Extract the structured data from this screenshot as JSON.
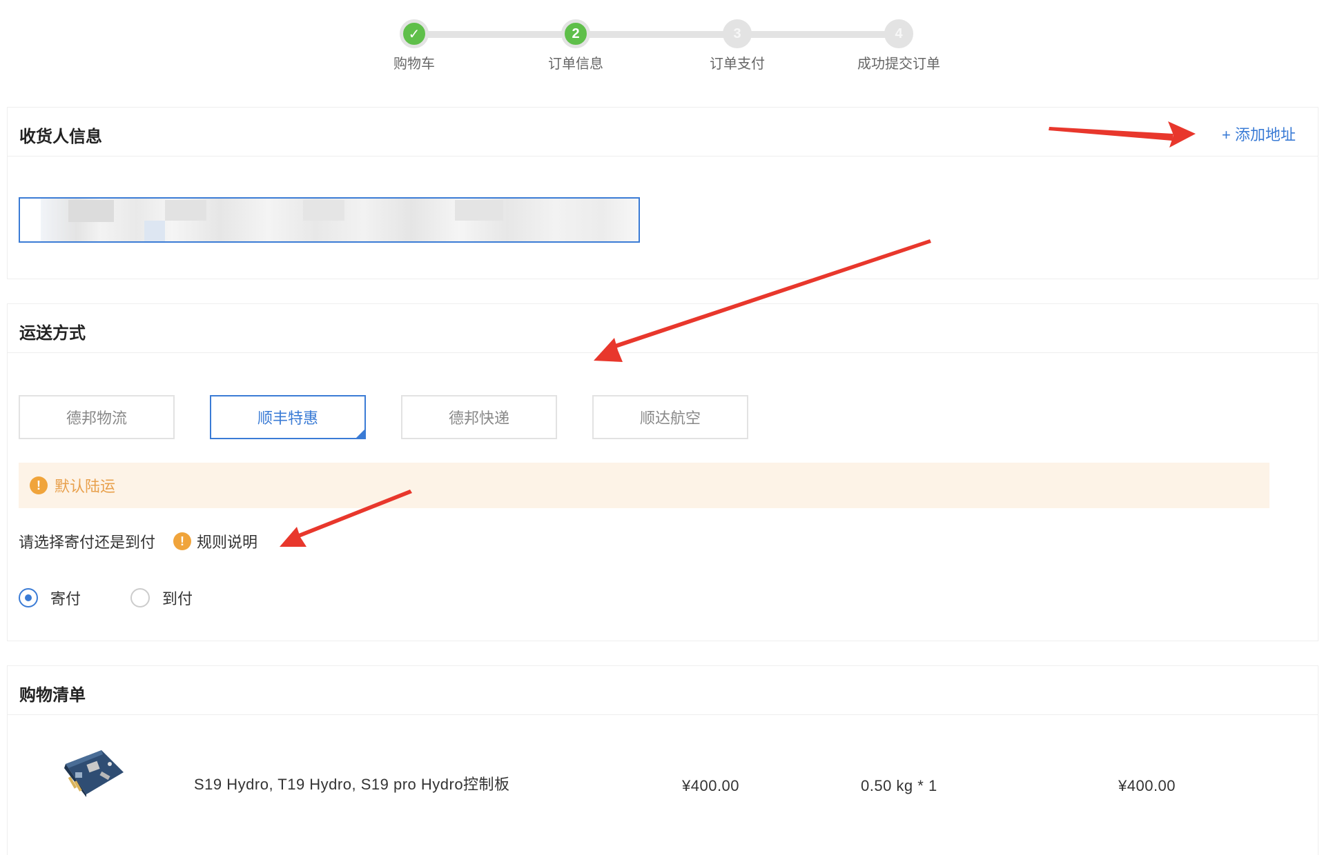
{
  "steps": [
    {
      "label": "购物车",
      "state": "done",
      "marker": "✓"
    },
    {
      "label": "订单信息",
      "state": "active",
      "marker": "2"
    },
    {
      "label": "订单支付",
      "state": "todo",
      "marker": "3"
    },
    {
      "label": "成功提交订单",
      "state": "todo",
      "marker": "4"
    }
  ],
  "consignee": {
    "title": "收货人信息",
    "add_address": "+ 添加地址"
  },
  "shipping": {
    "title": "运送方式",
    "options": [
      "德邦物流",
      "顺丰特惠",
      "德邦快递",
      "顺达航空"
    ],
    "selected_index": 1,
    "notice": "默认陆运",
    "question": "请选择寄付还是到付",
    "rules_link": "规则说明",
    "payment_options": [
      "寄付",
      "到付"
    ],
    "payment_selected": "寄付"
  },
  "cart": {
    "title": "购物清单",
    "items": [
      {
        "name": "S19 Hydro, T19 Hydro, S19 pro Hydro控制板",
        "unit_price": "¥400.00",
        "weight_qty": "0.50 kg * 1",
        "subtotal": "¥400.00"
      }
    ]
  },
  "colors": {
    "accent": "#3a7bd5",
    "step_done": "#5fbf4a",
    "warning": "#f0a43b",
    "notice_bg": "#fdf3e7",
    "annotation_arrow": "#e8372c"
  }
}
